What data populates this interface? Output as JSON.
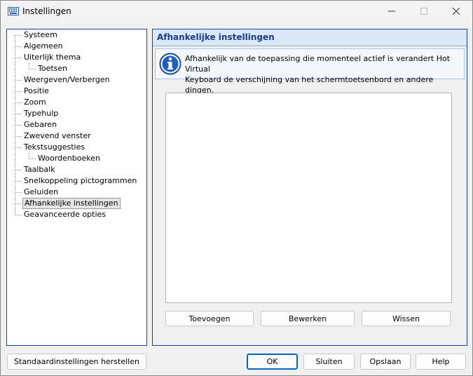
{
  "window": {
    "title": "Instellingen"
  },
  "tree": {
    "items": [
      {
        "label": "Systeem",
        "level": 0
      },
      {
        "label": "Algemeen",
        "level": 0
      },
      {
        "label": "Uiterlijk thema",
        "level": 0
      },
      {
        "label": "Toetsen",
        "level": 1
      },
      {
        "label": "Weergeven/Verbergen",
        "level": 0
      },
      {
        "label": "Positie",
        "level": 0
      },
      {
        "label": "Zoom",
        "level": 0
      },
      {
        "label": "Typehulp",
        "level": 0
      },
      {
        "label": "Gebaren",
        "level": 0
      },
      {
        "label": "Zwevend venster",
        "level": 0
      },
      {
        "label": "Tekstsuggesties",
        "level": 0
      },
      {
        "label": "Woordenboeken",
        "level": 1
      },
      {
        "label": "Taalbalk",
        "level": 0
      },
      {
        "label": "Snelkoppeling pictogrammen",
        "level": 0
      },
      {
        "label": "Geluiden",
        "level": 0
      },
      {
        "label": "Afhankelijke instellingen",
        "level": 0,
        "selected": true
      },
      {
        "label": "Geavanceerde opties",
        "level": 0
      }
    ]
  },
  "panel": {
    "title": "Afhankelijke instellingen",
    "info_icon": "info-icon",
    "info_text_line1": "Afhankelijk van de toepassing die momenteel actief is verandert Hot Virtual",
    "info_text_line2": "Keyboard de verschijning van het schermtoetsenbord en andere dingen.",
    "add_label": "Toevoegen",
    "edit_label": "Bewerken",
    "delete_label": "Wissen"
  },
  "footer": {
    "reset_label": "Standaardinstellingen herstellen",
    "ok_label": "OK",
    "close_label": "Sluiten",
    "save_label": "Opslaan",
    "help_label": "Help"
  },
  "colors": {
    "accent": "#0067c0",
    "panel_border": "#1f3fa1",
    "header_bg": "#dbe8f7",
    "header_text": "#1a3c8a"
  }
}
